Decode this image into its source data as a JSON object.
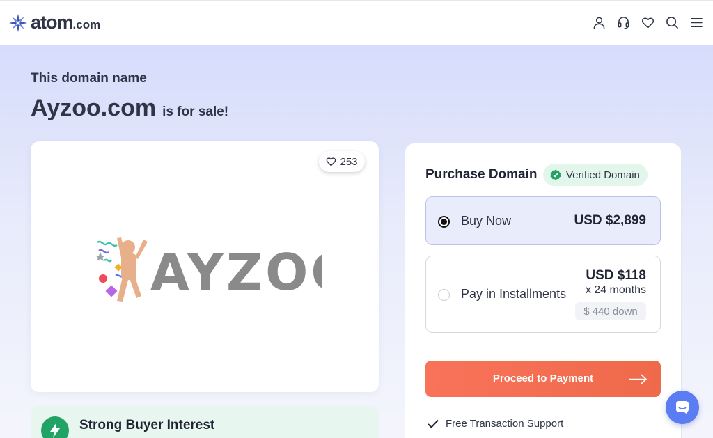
{
  "header": {
    "logo_text": "atom",
    "logo_suffix": ".com",
    "icons": [
      "user-icon",
      "support-headset-icon",
      "heart-icon",
      "search-icon",
      "menu-icon"
    ]
  },
  "hero": {
    "subtitle": "This domain name",
    "domain": "Ayzoo.com",
    "for_sale": "is for sale!"
  },
  "logo_card": {
    "likes": "253",
    "brand_text": "AYZOO"
  },
  "interest": {
    "title": "Strong Buyer Interest"
  },
  "purchase": {
    "title": "Purchase Domain",
    "verified_label": "Verified Domain",
    "options": [
      {
        "label": "Buy Now",
        "price": "USD $2,899",
        "selected": true
      },
      {
        "label": "Pay in Installments",
        "price": "USD $118",
        "term": "x 24 months",
        "down": "$ 440 down",
        "selected": false
      }
    ],
    "proceed_label": "Proceed to Payment",
    "features": [
      "Free Transaction Support"
    ]
  },
  "colors": {
    "accent": "#f8735a",
    "verified": "#21a366",
    "brand_blue": "#5b7df3",
    "text_dark": "#2f3547"
  }
}
